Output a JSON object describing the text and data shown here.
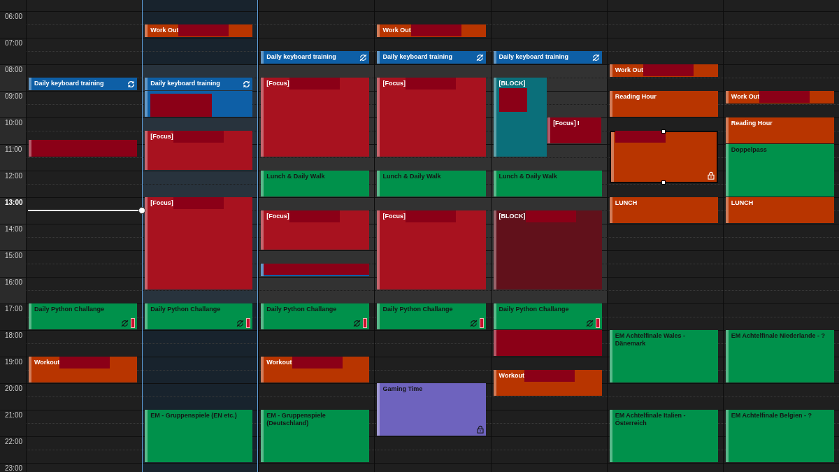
{
  "time_labels": [
    {
      "label": "06:00",
      "current": false
    },
    {
      "label": "07:00",
      "current": false
    },
    {
      "label": "08:00",
      "current": false
    },
    {
      "label": "09:00",
      "current": false
    },
    {
      "label": "10:00",
      "current": false
    },
    {
      "label": "11:00",
      "current": false
    },
    {
      "label": "12:00",
      "current": false
    },
    {
      "label": "13:00",
      "current": true
    },
    {
      "label": "14:00",
      "current": false
    },
    {
      "label": "15:00",
      "current": false
    },
    {
      "label": "16:00",
      "current": false
    },
    {
      "label": "17:00",
      "current": false
    },
    {
      "label": "18:00",
      "current": false
    },
    {
      "label": "19:00",
      "current": false
    },
    {
      "label": "20:00",
      "current": false
    },
    {
      "label": "21:00",
      "current": false
    },
    {
      "label": "22:00",
      "current": false
    },
    {
      "label": "23:00",
      "current": false
    }
  ],
  "days": [
    {
      "today": false,
      "workday": false,
      "events": [
        {
          "kind": "plain",
          "title": "Daily keyboard training",
          "color": "#0e5fa6",
          "selected": false,
          "badges": [
            {
              "kind": "recurring"
            }
          ]
        },
        {
          "kind": "plain",
          "color": "#8b0017",
          "selected": false
        },
        {
          "kind": "plain",
          "title": "Daily Python Challange",
          "color": "#00914b",
          "selected": false,
          "badges": [
            {
              "kind": "exception"
            },
            {
              "kind": "flag"
            }
          ]
        },
        {
          "kind": "masked",
          "title": "Workout",
          "color": "#b83500",
          "selected": false
        }
      ]
    },
    {
      "today": true,
      "workday": true,
      "events": [
        {
          "kind": "masked",
          "title": "Work Out",
          "color": "#b83500",
          "selected": false
        },
        {
          "kind": "plain",
          "title": "Daily keyboard training",
          "color": "#0e5fa6",
          "selected": false,
          "badges": [
            {
              "kind": "recurring"
            }
          ]
        },
        {
          "kind": "blocked",
          "color": "#0e5fa6",
          "selected": false
        },
        {
          "kind": "masked",
          "title": "[Focus]",
          "color": "#a8121f",
          "selected": false
        },
        {
          "kind": "masked",
          "title": "[Focus]",
          "color": "#a8121f",
          "selected": false
        },
        {
          "kind": "plain",
          "title": "Daily Python Challange",
          "color": "#00914b",
          "selected": false,
          "badges": [
            {
              "kind": "exception"
            },
            {
              "kind": "flag"
            }
          ]
        },
        {
          "kind": "plain",
          "title": "EM - Gruppenspiele (EN etc.)",
          "color": "#00914b",
          "selected": false
        }
      ]
    },
    {
      "today": false,
      "workday": true,
      "events": [
        {
          "kind": "plain",
          "title": "Daily keyboard training",
          "color": "#0e5fa6",
          "selected": false,
          "badges": [
            {
              "kind": "exception"
            }
          ]
        },
        {
          "kind": "masked",
          "title": "[Focus]",
          "color": "#a8121f",
          "selected": false
        },
        {
          "kind": "plain",
          "title": "Lunch & Daily Walk",
          "color": "#00914b",
          "selected": false
        },
        {
          "kind": "masked",
          "title": "[Focus]",
          "color": "#a8121f",
          "selected": false
        },
        {
          "kind": "covered",
          "color": "#0e5fa6",
          "selected": false
        },
        {
          "kind": "plain",
          "title": "Daily Python Challange",
          "color": "#00914b",
          "selected": false,
          "badges": [
            {
              "kind": "exception"
            },
            {
              "kind": "flag"
            }
          ]
        },
        {
          "kind": "masked",
          "title": "Workout",
          "color": "#b83500",
          "selected": false
        },
        {
          "kind": "plain",
          "title": "EM - Gruppenspiele (Deutschland)",
          "color": "#00914b",
          "selected": false
        }
      ]
    },
    {
      "today": false,
      "workday": true,
      "events": [
        {
          "kind": "masked",
          "title": "Work Out",
          "color": "#b83500",
          "selected": false
        },
        {
          "kind": "plain",
          "title": "Daily keyboard training",
          "color": "#0e5fa6",
          "selected": false,
          "badges": [
            {
              "kind": "exception"
            }
          ]
        },
        {
          "kind": "masked",
          "title": "[Focus]",
          "color": "#a8121f",
          "selected": false
        },
        {
          "kind": "plain",
          "title": "Lunch & Daily Walk",
          "color": "#00914b",
          "selected": false
        },
        {
          "kind": "masked",
          "title": "[Focus]",
          "color": "#a8121f",
          "selected": false
        },
        {
          "kind": "plain",
          "title": "Daily Python Challange",
          "color": "#00914b",
          "selected": false,
          "badges": [
            {
              "kind": "exception"
            },
            {
              "kind": "flag"
            }
          ]
        },
        {
          "kind": "plain",
          "title": "Gaming Time",
          "color": "#6e63be",
          "selected": false,
          "badges": [
            {
              "kind": "private"
            }
          ]
        }
      ]
    },
    {
      "today": false,
      "workday": true,
      "events": [
        {
          "kind": "plain",
          "title": "Daily keyboard training",
          "color": "#0e5fa6",
          "selected": false,
          "badges": [
            {
              "kind": "exception"
            }
          ]
        },
        {
          "kind": "blocked",
          "title": "[BLOCK]",
          "color": "#0b6f7a",
          "selected": false
        },
        {
          "kind": "plain",
          "title": "[Focus] I",
          "color": "#8b0017",
          "selected": false
        },
        {
          "kind": "plain",
          "title": "Lunch & Daily Walk",
          "color": "#00914b",
          "selected": false
        },
        {
          "kind": "masked",
          "title": "[BLOCK]",
          "color": "#61111b",
          "selected": false
        },
        {
          "kind": "plain",
          "title": "Daily Python Challange",
          "color": "#00914b",
          "selected": false,
          "badges": [
            {
              "kind": "exception"
            },
            {
              "kind": "flag"
            }
          ]
        },
        {
          "kind": "plain",
          "color": "#8b0017",
          "selected": false
        },
        {
          "kind": "masked",
          "title": "Workout",
          "color": "#b83500",
          "selected": false
        }
      ]
    },
    {
      "today": false,
      "workday": false,
      "events": [
        {
          "kind": "masked",
          "title": "Work Out",
          "color": "#b83500",
          "selected": false
        },
        {
          "kind": "plain",
          "title": "Reading Hour",
          "color": "#b83500",
          "selected": false
        },
        {
          "kind": "masked",
          "color": "#b83500",
          "selected": true,
          "badges": [
            {
              "kind": "private"
            }
          ]
        },
        {
          "kind": "plain",
          "title": "LUNCH",
          "color": "#b83500",
          "selected": false
        },
        {
          "kind": "plain",
          "title": "EM Achtelfinale Wales - Dänemark",
          "color": "#00914b",
          "selected": false
        },
        {
          "kind": "plain",
          "title": "EM Achtelfinale Italien - Österreich",
          "color": "#00914b",
          "selected": false
        }
      ]
    },
    {
      "today": false,
      "workday": false,
      "events": [
        {
          "kind": "masked",
          "title": "Work Out",
          "color": "#b83500",
          "selected": false
        },
        {
          "kind": "plain",
          "title": "Reading Hour",
          "color": "#b83500",
          "selected": false
        },
        {
          "kind": "plain",
          "title": "Doppelpass",
          "color": "#00914b",
          "selected": false
        },
        {
          "kind": "plain",
          "title": "LUNCH",
          "color": "#b83500",
          "selected": false
        },
        {
          "kind": "plain",
          "title": "EM Achtelfinale Niederlande - ?",
          "color": "#00914b",
          "selected": false
        },
        {
          "kind": "plain",
          "title": "EM Achtelfinale Belgien - ?",
          "color": "#00914b",
          "selected": false
        }
      ]
    }
  ]
}
